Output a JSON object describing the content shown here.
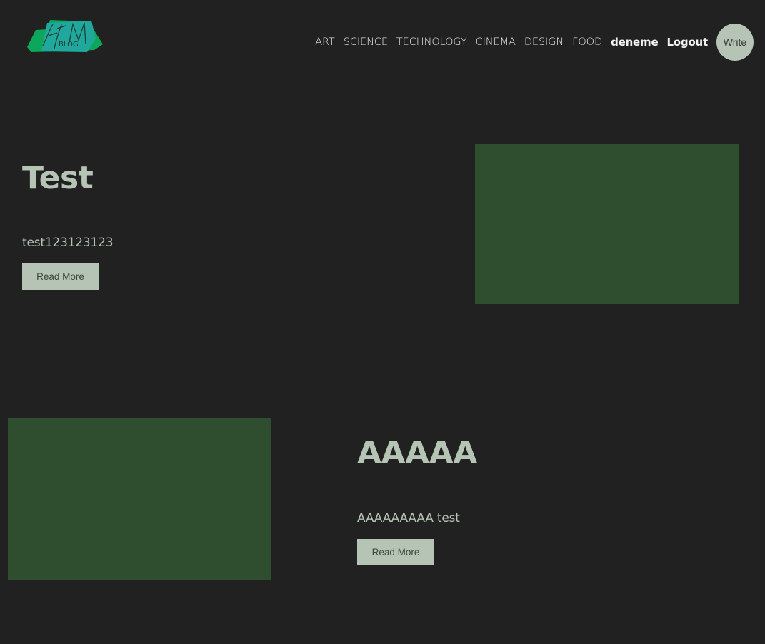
{
  "logo": {
    "text": "AFM",
    "subtext": "BLOG",
    "colors": {
      "primary": "#1fa89b",
      "secondary": "#0ca75a"
    }
  },
  "nav": {
    "categories": [
      "ART",
      "SCIENCE",
      "TECHNOLOGY",
      "CINEMA",
      "DESIGN",
      "FOOD"
    ],
    "username": "deneme",
    "logout_label": "Logout",
    "write_label": "Write"
  },
  "posts": [
    {
      "title": "Test",
      "description": "test123123123",
      "button_label": "Read More"
    },
    {
      "title": "AAAAA",
      "description": "AAAAAAAAA test",
      "button_label": "Read More"
    }
  ],
  "colors": {
    "background": "#212121",
    "accent": "#b5c4b4",
    "image_placeholder": "#2f4d2f"
  }
}
